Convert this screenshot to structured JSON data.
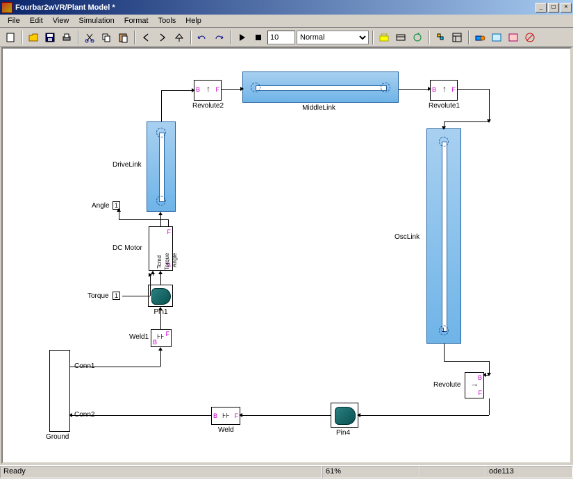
{
  "window": {
    "title": "Fourbar2wVR/Plant  Model *"
  },
  "menu": {
    "file": "File",
    "edit": "Edit",
    "view": "View",
    "simulation": "Simulation",
    "format": "Format",
    "tools": "Tools",
    "help": "Help"
  },
  "toolbar": {
    "stop_time": "10",
    "mode": "Normal"
  },
  "blocks": {
    "revolute2": "Revolute2",
    "middlelink": "MiddleLink",
    "revolute1": "Revolute1",
    "drivelink": "DriveLink",
    "angle_port": "Angle",
    "angle_num": "1",
    "dcmotor": "DC Motor",
    "tcmd": "Tcmd",
    "angle_out": "Angle",
    "torq": "Torque",
    "torque_port": "Torque",
    "torque_num": "1",
    "pin1": "Pin1",
    "weld1": "Weld1",
    "osclink": "OscLink",
    "revolute": "Revolute",
    "pin4": "Pin4",
    "weld": "Weld",
    "conn1": "Conn1",
    "conn2": "Conn2",
    "ground": "Ground",
    "B": "B",
    "F": "F"
  },
  "status": {
    "ready": "Ready",
    "zoom": "61%",
    "solver": "ode113"
  }
}
